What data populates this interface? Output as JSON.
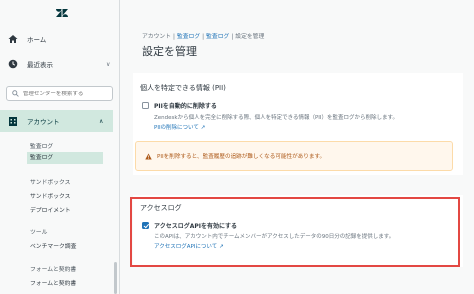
{
  "sidebar": {
    "logo": "zendesk-logo",
    "home_label": "ホーム",
    "recent_label": "最近表示",
    "search_placeholder": "管理センターを検索する",
    "account_label": "アカウント",
    "items": [
      {
        "label": "監査ログ",
        "active": false
      },
      {
        "label": "監査ログ",
        "active": true
      }
    ],
    "groups": [
      {
        "heading": "サンドボックス",
        "item": "サンドボックス"
      },
      {
        "heading": "デプロイメント",
        "item": ""
      },
      {
        "heading": "ツール",
        "item": "ベンチマーク調査"
      },
      {
        "heading": "フォームと契約書",
        "item": "フォームと契約書"
      }
    ]
  },
  "breadcrumb": {
    "items": [
      "アカウント",
      "監査ログ",
      "監査ログ"
    ],
    "current": "設定を管理"
  },
  "page_title": "設定を管理",
  "pii": {
    "heading": "個人を特定できる情報 (PII)",
    "checkbox_label": "PIIを自動的に削除する",
    "checked": false,
    "description": "Zendeskから個人を完全に削除する際、個人を特定できる情報（PII）を監査ログから削除します。",
    "link": "PIIの削除について"
  },
  "warning": {
    "text": "PIIを削除すると、監査履歴の追跡が難しくなる可能性があります。"
  },
  "access_log": {
    "heading": "アクセスログ",
    "checkbox_label": "アクセスログAPIを有効にする",
    "checked": true,
    "description": "このAPIは、アカウント内でチームメンバーがアクセスしたデータの90日分の記録を提供します。",
    "link": "アクセスログAPIについて"
  },
  "colors": {
    "brand": "#03363d",
    "link": "#1f73b7",
    "highlight": "#e34843",
    "warning_text": "#ad5918",
    "warning_bg": "#fff7ed",
    "active_bg": "#d1e8df"
  }
}
